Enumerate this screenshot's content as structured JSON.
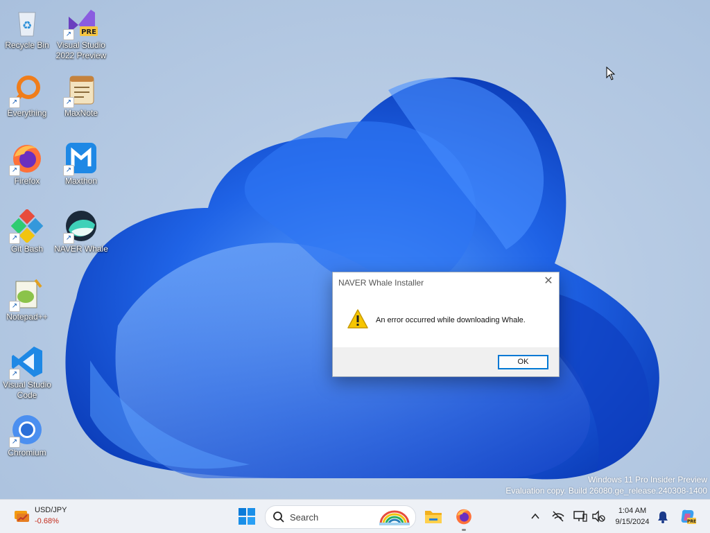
{
  "desktop": {
    "icons": [
      {
        "label": "Recycle Bin",
        "icon": "recycle-bin-icon"
      },
      {
        "label": "Visual Studio 2022 Preview",
        "label_line1": "Visual Studio",
        "label_line2": "2022 Preview",
        "badge": "PRE",
        "icon": "visual-studio-icon"
      },
      {
        "label": "Everything",
        "icon": "everything-search-icon"
      },
      {
        "label": "MaxNote",
        "icon": "maxnote-icon"
      },
      {
        "label": "Firefox",
        "icon": "firefox-icon"
      },
      {
        "label": "Maxthon",
        "icon": "maxthon-icon"
      },
      {
        "label": "Git Bash",
        "icon": "git-bash-icon"
      },
      {
        "label": "NAVER Whale",
        "icon": "naver-whale-icon"
      },
      {
        "label": "Notepad++",
        "icon": "notepadpp-icon"
      },
      {
        "label": "Visual Studio Code",
        "label_line1": "Visual Studio",
        "label_line2": "Code",
        "icon": "vscode-icon"
      },
      {
        "label": "Chromium",
        "icon": "chromium-icon"
      }
    ]
  },
  "dialog": {
    "title": "NAVER Whale Installer",
    "close_glyph": "✕",
    "message": "An error occurred while downloading Whale.",
    "ok_label": "OK"
  },
  "watermark": {
    "line1": "Windows 11 Pro Insider Preview",
    "line2": "Evaluation copy. Build 26080.ge_release.240308-1400"
  },
  "taskbar": {
    "widget": {
      "pair": "USD/JPY",
      "change": "-0.68%"
    },
    "search": {
      "placeholder": "Search"
    },
    "clock": {
      "time": "1:04 AM",
      "date": "9/15/2024"
    }
  },
  "colors": {
    "accent": "#0078d4",
    "negative": "#c42b1c",
    "bloom": "#1a5de0"
  }
}
